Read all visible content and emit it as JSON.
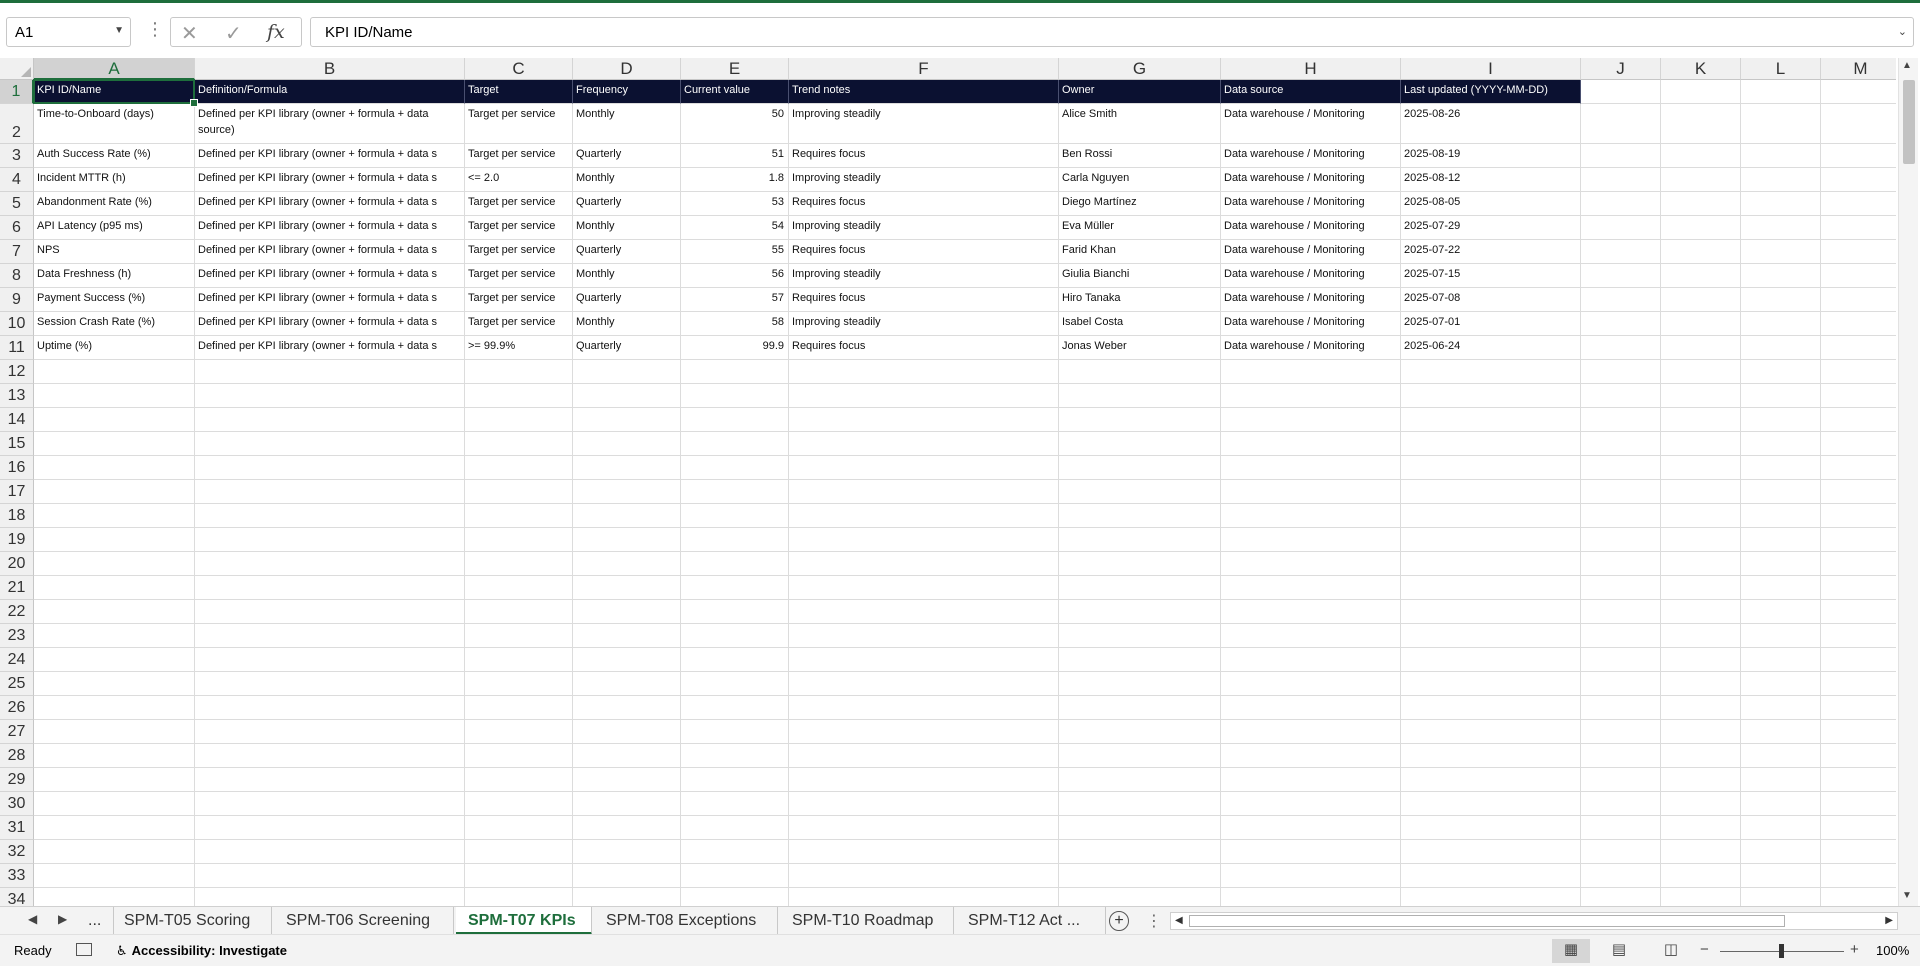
{
  "formula_bar": {
    "name_box": "A1",
    "cancel_icon": "✕",
    "enter_icon": "✓",
    "fx_label": "fx",
    "content": "KPI ID/Name"
  },
  "columns": [
    "A",
    "B",
    "C",
    "D",
    "E",
    "F",
    "G",
    "H",
    "I",
    "J",
    "K",
    "L",
    "M"
  ],
  "rows": [
    1,
    2,
    3,
    4,
    5,
    6,
    7,
    8,
    9,
    10,
    11,
    12,
    13,
    14,
    15,
    16,
    17,
    18,
    19,
    20,
    21,
    22,
    23,
    24,
    25,
    26,
    27,
    28,
    29,
    30,
    31,
    32,
    33,
    34
  ],
  "header_row": [
    "KPI ID/Name",
    "Definition/Formula",
    "Target",
    "Frequency",
    "Current value",
    "Trend notes",
    "Owner",
    "Data source",
    "Last updated (YYYY-MM-DD)"
  ],
  "data_rows": [
    [
      "Time-to-Onboard (days)",
      "Defined per KPI library (owner + formula + data source)",
      "Target per service",
      "Monthly",
      "50",
      "Improving steadily",
      "Alice Smith",
      "Data warehouse / Monitoring",
      "2025-08-26"
    ],
    [
      "Auth Success Rate (%)",
      "Defined per KPI library (owner + formula + data s",
      "Target per service",
      "Quarterly",
      "51",
      "Requires focus",
      "Ben Rossi",
      "Data warehouse / Monitoring",
      "2025-08-19"
    ],
    [
      "Incident MTTR (h)",
      "Defined per KPI library (owner + formula + data s",
      "<= 2.0",
      "Monthly",
      "1.8",
      "Improving steadily",
      "Carla Nguyen",
      "Data warehouse / Monitoring",
      "2025-08-12"
    ],
    [
      "Abandonment Rate (%)",
      "Defined per KPI library (owner + formula + data s",
      "Target per service",
      "Quarterly",
      "53",
      "Requires focus",
      "Diego Martínez",
      "Data warehouse / Monitoring",
      "2025-08-05"
    ],
    [
      "API Latency (p95 ms)",
      "Defined per KPI library (owner + formula + data s",
      "Target per service",
      "Monthly",
      "54",
      "Improving steadily",
      "Eva Müller",
      "Data warehouse / Monitoring",
      "2025-07-29"
    ],
    [
      "NPS",
      "Defined per KPI library (owner + formula + data s",
      "Target per service",
      "Quarterly",
      "55",
      "Requires focus",
      "Farid Khan",
      "Data warehouse / Monitoring",
      "2025-07-22"
    ],
    [
      "Data Freshness (h)",
      "Defined per KPI library (owner + formula + data s",
      "Target per service",
      "Monthly",
      "56",
      "Improving steadily",
      "Giulia Bianchi",
      "Data warehouse / Monitoring",
      "2025-07-15"
    ],
    [
      "Payment Success (%)",
      "Defined per KPI library (owner + formula + data s",
      "Target per service",
      "Quarterly",
      "57",
      "Requires focus",
      "Hiro Tanaka",
      "Data warehouse / Monitoring",
      "2025-07-08"
    ],
    [
      "Session Crash Rate (%)",
      "Defined per KPI library (owner + formula + data s",
      "Target per service",
      "Monthly",
      "58",
      "Improving steadily",
      "Isabel Costa",
      "Data warehouse / Monitoring",
      "2025-07-01"
    ],
    [
      "Uptime (%)",
      "Defined per KPI library (owner + formula + data s",
      ">= 99.9%",
      "Quarterly",
      "99.9",
      "Requires focus",
      "Jonas Weber",
      "Data warehouse / Monitoring",
      "2025-06-24"
    ]
  ],
  "sheet_tabs": {
    "overflow": "...",
    "tabs": [
      "SPM-T05 Scoring",
      "SPM-T06 Screening",
      "SPM-T07 KPIs",
      "SPM-T08 Exceptions",
      "SPM-T10 Roadmap",
      "SPM-T12 Act  ..."
    ],
    "active_index": 2
  },
  "status_bar": {
    "ready": "Ready",
    "accessibility": "Accessibility: Investigate",
    "zoom": "100%"
  },
  "colors": {
    "accent": "#1e6e3c",
    "header_fill": "#0b1131",
    "header_text": "#ffffff"
  }
}
